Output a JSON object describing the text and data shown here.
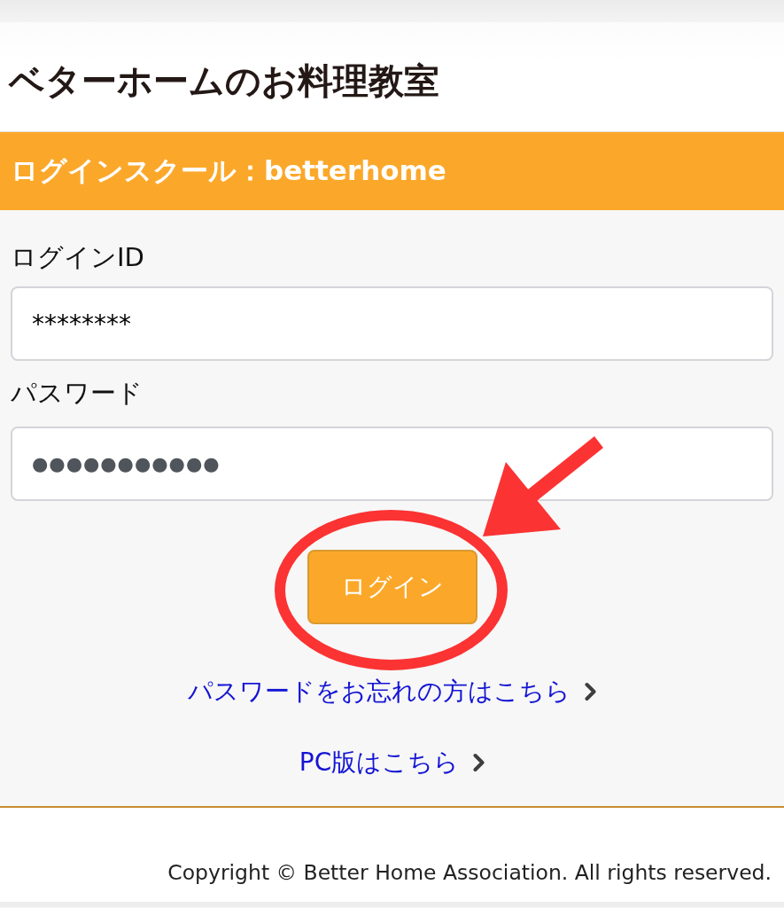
{
  "header": {
    "logo": "ベターホームのお料理教室"
  },
  "banner": {
    "title": "ログインスクール：betterhome"
  },
  "form": {
    "fields": [
      {
        "kind": "text",
        "label": "ログインID",
        "value": "********"
      },
      {
        "kind": "password",
        "label": "パスワード",
        "value": "●●●●●●●●●●●"
      }
    ],
    "submit": "ログイン"
  },
  "links": [
    {
      "label": "パスワードをお忘れの方はこちら"
    },
    {
      "label": "PC版はこちら"
    }
  ],
  "annotations": {
    "highlight_ellipse": true,
    "pointer_arrow": true
  },
  "footer": {
    "copyright": "Copyright © Better Home Association. All rights reserved."
  }
}
